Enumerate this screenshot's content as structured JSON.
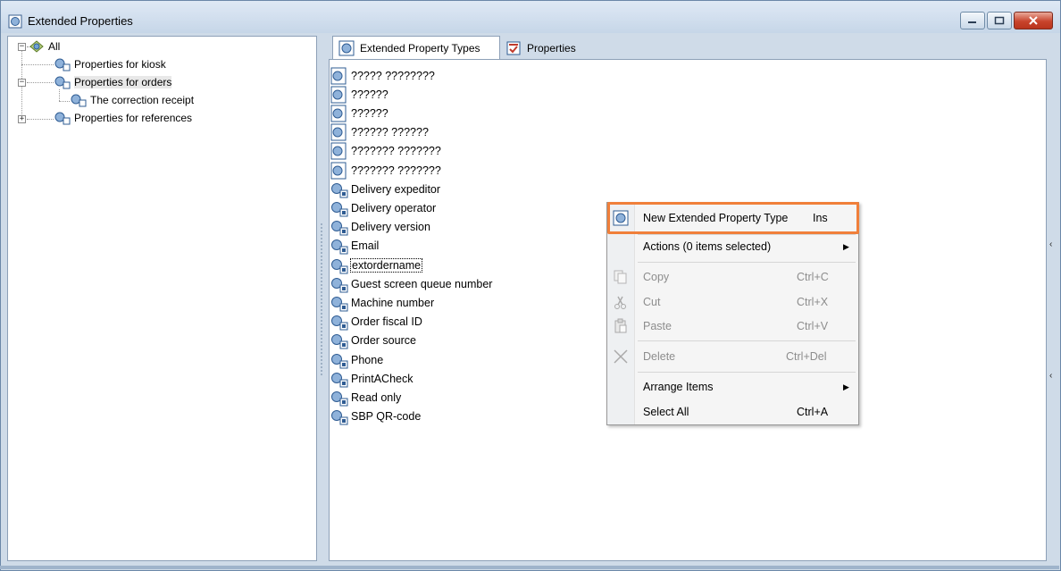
{
  "window": {
    "title": "Extended Properties"
  },
  "tree": {
    "root": "All",
    "items": [
      {
        "label": "Properties for kiosk"
      },
      {
        "label": "Properties for orders"
      },
      {
        "label": "The correction receipt"
      },
      {
        "label": "Properties for references"
      }
    ]
  },
  "tabs": [
    {
      "label": "Extended Property Types",
      "active": true
    },
    {
      "label": "Properties",
      "active": false
    }
  ],
  "list": {
    "items": [
      "????? ????????",
      "??????",
      "??????",
      "?????? ??????",
      "??????? ???????",
      "??????? ???????",
      "Delivery expeditor",
      "Delivery operator",
      "Delivery version",
      "Email",
      "extordername",
      "Guest screen queue number",
      "Machine number",
      "Order fiscal ID",
      "Order source",
      "Phone",
      "PrintACheck",
      "Read only",
      "SBP QR-code"
    ]
  },
  "context_menu": {
    "new_type": {
      "label": "New Extended Property Type",
      "shortcut": "Ins"
    },
    "actions": {
      "label": "Actions (0 items selected)"
    },
    "copy": {
      "label": "Copy",
      "shortcut": "Ctrl+C"
    },
    "cut": {
      "label": "Cut",
      "shortcut": "Ctrl+X"
    },
    "paste": {
      "label": "Paste",
      "shortcut": "Ctrl+V"
    },
    "delete": {
      "label": "Delete",
      "shortcut": "Ctrl+Del"
    },
    "arrange": {
      "label": "Arrange Items"
    },
    "select_all": {
      "label": "Select All",
      "shortcut": "Ctrl+A"
    }
  },
  "colors": {
    "highlight": "#f07f3a",
    "frame": "#cfdbe8"
  }
}
